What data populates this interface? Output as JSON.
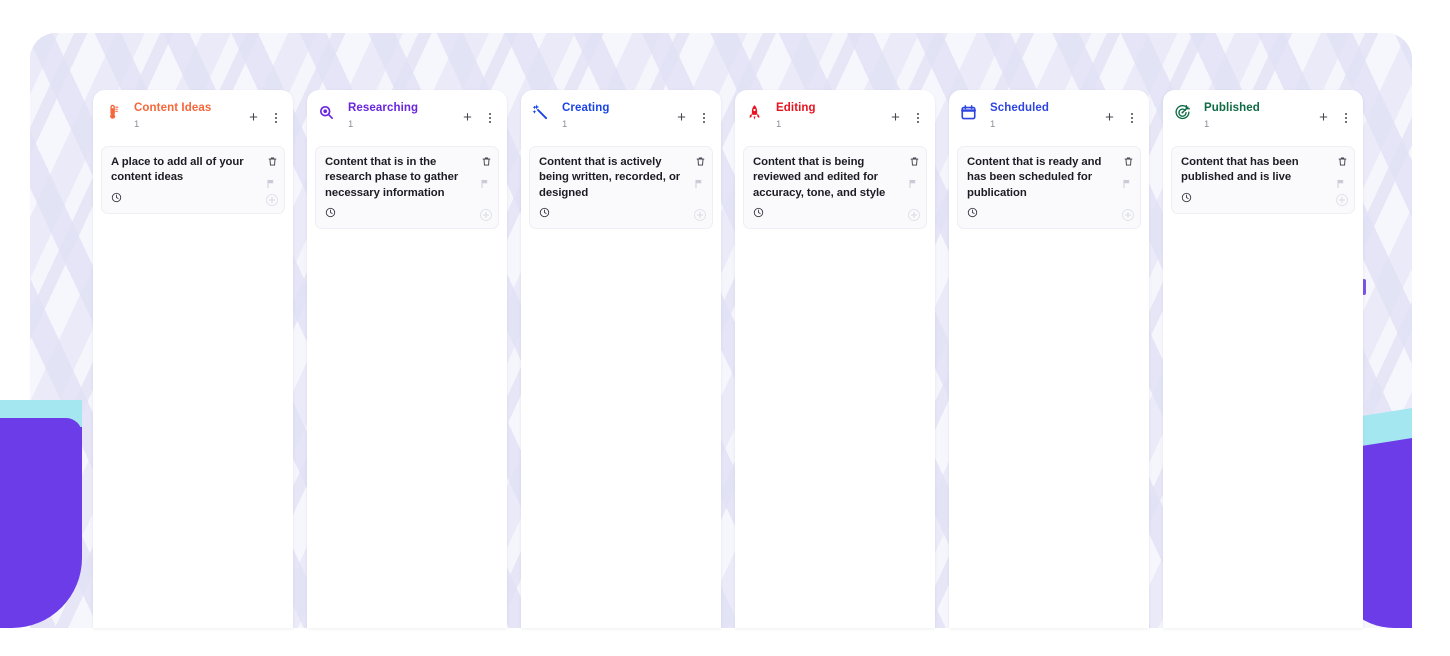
{
  "board": {
    "name": "content-pipeline-kanban",
    "background_pattern": "chevron",
    "accent_purple": "#6c3ce9",
    "accent_cyan": "#a5e7f0"
  },
  "column_actions": {
    "add_label": "+",
    "add_icon": "plus-icon",
    "menu_icon": "more-vertical-icon"
  },
  "card_icons": {
    "delete": "trash-icon",
    "flag": "flag-icon",
    "add": "circle-plus-icon",
    "clock": "clock-icon"
  },
  "columns": [
    {
      "id": "content-ideas",
      "title": "Content Ideas",
      "count": "1",
      "color": "#f4673a",
      "icon": "thermometer-icon",
      "cards": [
        {
          "title": "A place to add all of your content ideas"
        }
      ]
    },
    {
      "id": "researching",
      "title": "Researching",
      "count": "1",
      "color": "#6925e0",
      "icon": "magnifier-icon",
      "cards": [
        {
          "title": "Content that is in the research phase to gather necessary information"
        }
      ]
    },
    {
      "id": "creating",
      "title": "Creating",
      "count": "1",
      "color": "#1a44e8",
      "icon": "magic-wand-icon",
      "cards": [
        {
          "title": "Content that is actively being written, recorded, or designed"
        }
      ]
    },
    {
      "id": "editing",
      "title": "Editing",
      "count": "1",
      "color": "#e81220",
      "icon": "rocket-icon",
      "cards": [
        {
          "title": "Content that is being reviewed and edited for accuracy, tone, and style"
        }
      ]
    },
    {
      "id": "scheduled",
      "title": "Scheduled",
      "count": "1",
      "color": "#2f45e0",
      "icon": "calendar-icon",
      "cards": [
        {
          "title": "Content that is ready and has been scheduled for publication"
        }
      ]
    },
    {
      "id": "published",
      "title": "Published",
      "count": "1",
      "color": "#0f6b44",
      "icon": "dart-target-icon",
      "cards": [
        {
          "title": "Content that has been published and is live"
        }
      ]
    }
  ]
}
